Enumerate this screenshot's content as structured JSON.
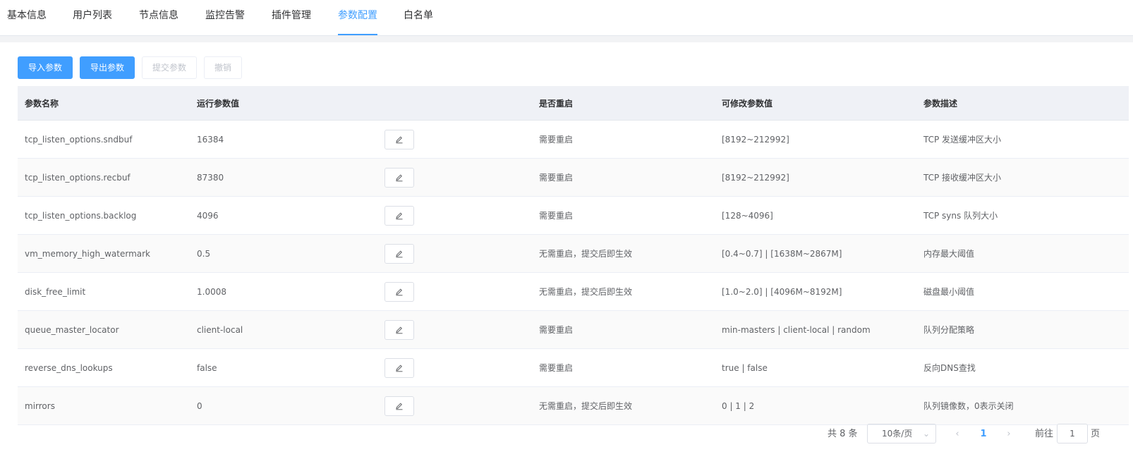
{
  "tabs": [
    {
      "label": "基本信息",
      "active": false
    },
    {
      "label": "用户列表",
      "active": false
    },
    {
      "label": "节点信息",
      "active": false
    },
    {
      "label": "监控告警",
      "active": false
    },
    {
      "label": "插件管理",
      "active": false
    },
    {
      "label": "参数配置",
      "active": true
    },
    {
      "label": "白名单",
      "active": false
    }
  ],
  "toolbar": {
    "import_label": "导入参数",
    "export_label": "导出参数",
    "submit_label": "提交参数",
    "revoke_label": "撤销"
  },
  "table": {
    "columns": [
      "参数名称",
      "运行参数值",
      "",
      "是否重启",
      "可修改参数值",
      "参数描述"
    ],
    "rows": [
      {
        "name": "tcp_listen_options.sndbuf",
        "value": "16384",
        "restart": "需要重启",
        "range": "[8192~212992]",
        "desc": "TCP 发送缓冲区大小"
      },
      {
        "name": "tcp_listen_options.recbuf",
        "value": "87380",
        "restart": "需要重启",
        "range": "[8192~212992]",
        "desc": "TCP 接收缓冲区大小"
      },
      {
        "name": "tcp_listen_options.backlog",
        "value": "4096",
        "restart": "需要重启",
        "range": "[128~4096]",
        "desc": "TCP syns 队列大小"
      },
      {
        "name": "vm_memory_high_watermark",
        "value": "0.5",
        "restart": "无需重启，提交后即生效",
        "range": "[0.4~0.7] | [1638M~2867M]",
        "desc": "内存最大阈值"
      },
      {
        "name": "disk_free_limit",
        "value": "1.0008",
        "restart": "无需重启，提交后即生效",
        "range": "[1.0~2.0] | [4096M~8192M]",
        "desc": "磁盘最小阈值"
      },
      {
        "name": "queue_master_locator",
        "value": "client-local",
        "restart": "需要重启",
        "range": "min-masters | client-local | random",
        "desc": "队列分配策略"
      },
      {
        "name": "reverse_dns_lookups",
        "value": "false",
        "restart": "需要重启",
        "range": "true | false",
        "desc": "反向DNS查找"
      },
      {
        "name": "mirrors",
        "value": "0",
        "restart": "无需重启，提交后即生效",
        "range": "0 | 1 | 2",
        "desc": "队列镜像数，0表示关闭"
      }
    ]
  },
  "pagination": {
    "total": "共 8 条",
    "page_size": "10条/页",
    "current": "1",
    "goto_label": "前往",
    "goto_value": "1",
    "unit": "页"
  },
  "icons": {
    "edit": "pencil-edit-icon",
    "prev": "chevron-left-icon",
    "next": "chevron-right-icon",
    "size_dropdown": "chevron-down-icon"
  },
  "colors": {
    "primary": "#409eff",
    "header_bg": "#eff1f6",
    "disabled_text": "#c0c4cc"
  }
}
